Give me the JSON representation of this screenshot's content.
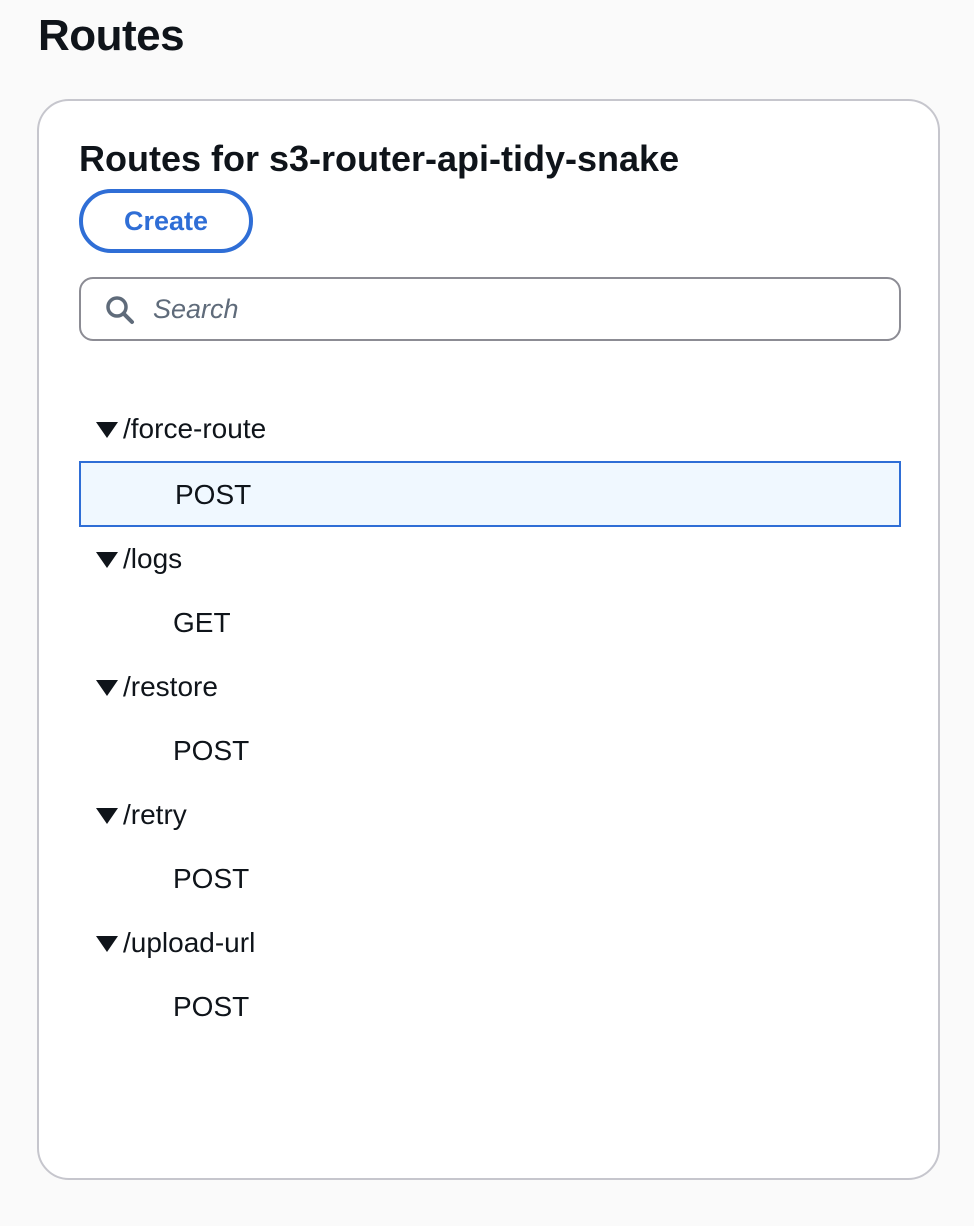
{
  "page": {
    "title": "Routes"
  },
  "panel": {
    "title": "Routes for s3-router-api-tidy-snake",
    "create_label": "Create",
    "search_placeholder": "Search",
    "search_value": ""
  },
  "routes": [
    {
      "path": "/force-route",
      "expanded": true,
      "methods": [
        {
          "label": "POST",
          "selected": true
        }
      ]
    },
    {
      "path": "/logs",
      "expanded": true,
      "methods": [
        {
          "label": "GET",
          "selected": false
        }
      ]
    },
    {
      "path": "/restore",
      "expanded": true,
      "methods": [
        {
          "label": "POST",
          "selected": false
        }
      ]
    },
    {
      "path": "/retry",
      "expanded": true,
      "methods": [
        {
          "label": "POST",
          "selected": false
        }
      ]
    },
    {
      "path": "/upload-url",
      "expanded": true,
      "methods": [
        {
          "label": "POST",
          "selected": false
        }
      ]
    }
  ],
  "colors": {
    "accent": "#2f6ed6",
    "selected_bg": "#f0f8ff",
    "text": "#0f141a",
    "panel_border": "#c6c6cd"
  }
}
